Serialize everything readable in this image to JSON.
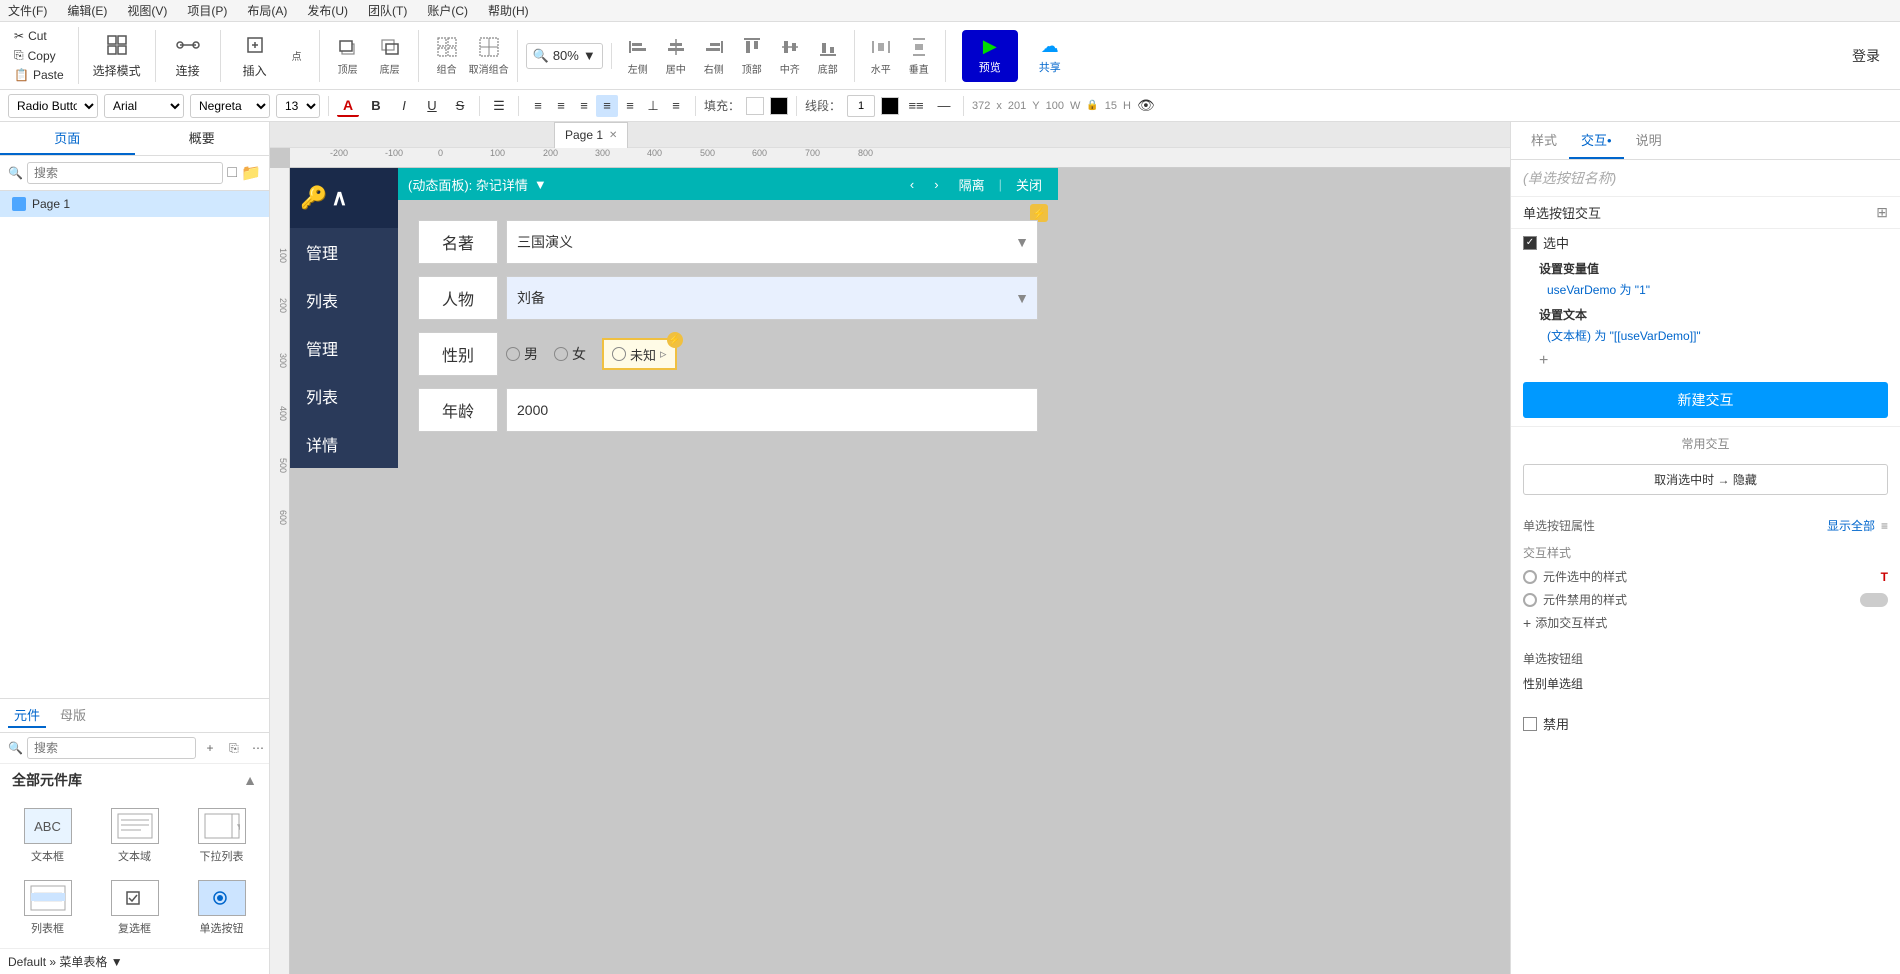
{
  "menu": {
    "items": [
      "文件(F)",
      "编辑(E)",
      "视图(V)",
      "项目(P)",
      "布局(A)",
      "发布(U)",
      "团队(T)",
      "账户(C)",
      "帮助(H)"
    ]
  },
  "clipboard": {
    "cut": "✂ Cut",
    "copy": "Copy",
    "paste": "Paste"
  },
  "toolbar": {
    "select_mode": "选择模式",
    "connect": "连接",
    "insert": "插入",
    "dot": "点",
    "top_layer": "顶层",
    "bottom_layer": "底层",
    "group": "组合",
    "ungroup": "取消组合",
    "align_left": "左侧",
    "align_center": "居中",
    "align_right": "右侧",
    "align_top": "顶部",
    "align_middle": "中齐",
    "align_bottom": "底部",
    "align_h": "水平",
    "align_v": "垂直",
    "zoom": "80%",
    "preview": "预览",
    "share": "共享",
    "login": "登录"
  },
  "format_toolbar": {
    "component_type": "Radio Button",
    "font_family": "Arial",
    "font_weight": "Negreta",
    "font_size": "13",
    "fill_label": "填充：",
    "line_label": "线段：",
    "line_width": "1",
    "x_coord": "372",
    "y_coord": "201",
    "w_coord": "100",
    "h_coord": "15",
    "x_label": "x",
    "y_label": "Y",
    "w_label": "W",
    "h_label": "H"
  },
  "left_panel": {
    "tab1": "页面",
    "tab2": "概要",
    "search_placeholder": "搜索",
    "page1": "Page 1"
  },
  "page_tab": {
    "label": "Page 1"
  },
  "canvas": {
    "dialog": {
      "title": "(动态面板): 杂记详情",
      "separator": "▼",
      "btn_prev": "‹",
      "btn_next": "›",
      "btn_isolate": "隔离",
      "btn_close": "关闭",
      "fields": [
        {
          "label": "名著",
          "value": "三国演义",
          "type": "select"
        },
        {
          "label": "人物",
          "value": "刘备",
          "type": "select"
        },
        {
          "label": "性别",
          "type": "radio",
          "options": [
            "男",
            "女"
          ],
          "extra": "未知"
        },
        {
          "label": "年龄",
          "value": "2000",
          "type": "input"
        }
      ]
    }
  },
  "sidebar_nav": {
    "logo": "钥 ∧",
    "items": [
      "管理",
      "列表",
      "管理",
      "列表",
      "详情"
    ]
  },
  "right_panel": {
    "tab_style": "样式",
    "tab_interact": "交互",
    "tab_interact_dot": "•",
    "tab_explain": "说明",
    "component_name_placeholder": "(单选按钮名称)",
    "interaction_section": "单选按钮交互",
    "selected_label": "选中",
    "set_var_title": "设置变量值",
    "set_var_content": "useVarDemo 为 \"1\"",
    "set_text_title": "设置文本",
    "set_text_content": "(文本框) 为 \"[[useVarDemo]]\"",
    "plus_label": "+",
    "new_interaction": "新建交互",
    "common_interactions": "常用交互",
    "cancel_select": "取消选中时 → 隐藏",
    "prop_section": "单选按钮属性",
    "prop_show_all": "显示全部",
    "prop_icon": "≡",
    "interact_style_label": "交互样式",
    "interact_style1": "元件选中的样式",
    "interact_style2": "元件禁用的样式",
    "add_style": "添加交互样式",
    "radio_group_section": "单选按钮组",
    "radio_group_value": "性别单选组",
    "disable_label": "禁用"
  },
  "components": {
    "tab1": "元件",
    "tab2": "母版",
    "search_placeholder": "搜索",
    "section_title": "全部元件库",
    "items": [
      {
        "label": "文本框",
        "icon_text": "ABC"
      },
      {
        "label": "文本域",
        "icon_text": "≡"
      },
      {
        "label": "下拉列表",
        "icon_text": "▼"
      },
      {
        "label": "列表框",
        "icon_text": "☰"
      },
      {
        "label": "复选框",
        "icon_text": "✓"
      },
      {
        "label": "单选按钮",
        "icon_text": "◉"
      }
    ],
    "default_style": "Default » 菜单表格 ▼"
  },
  "ruler": {
    "marks_h": [
      "-200",
      "-100",
      "0",
      "100",
      "200",
      "300",
      "400",
      "500",
      "600",
      "700",
      "800"
    ],
    "marks_v": [
      "100",
      "200",
      "300",
      "400",
      "500",
      "600"
    ]
  }
}
